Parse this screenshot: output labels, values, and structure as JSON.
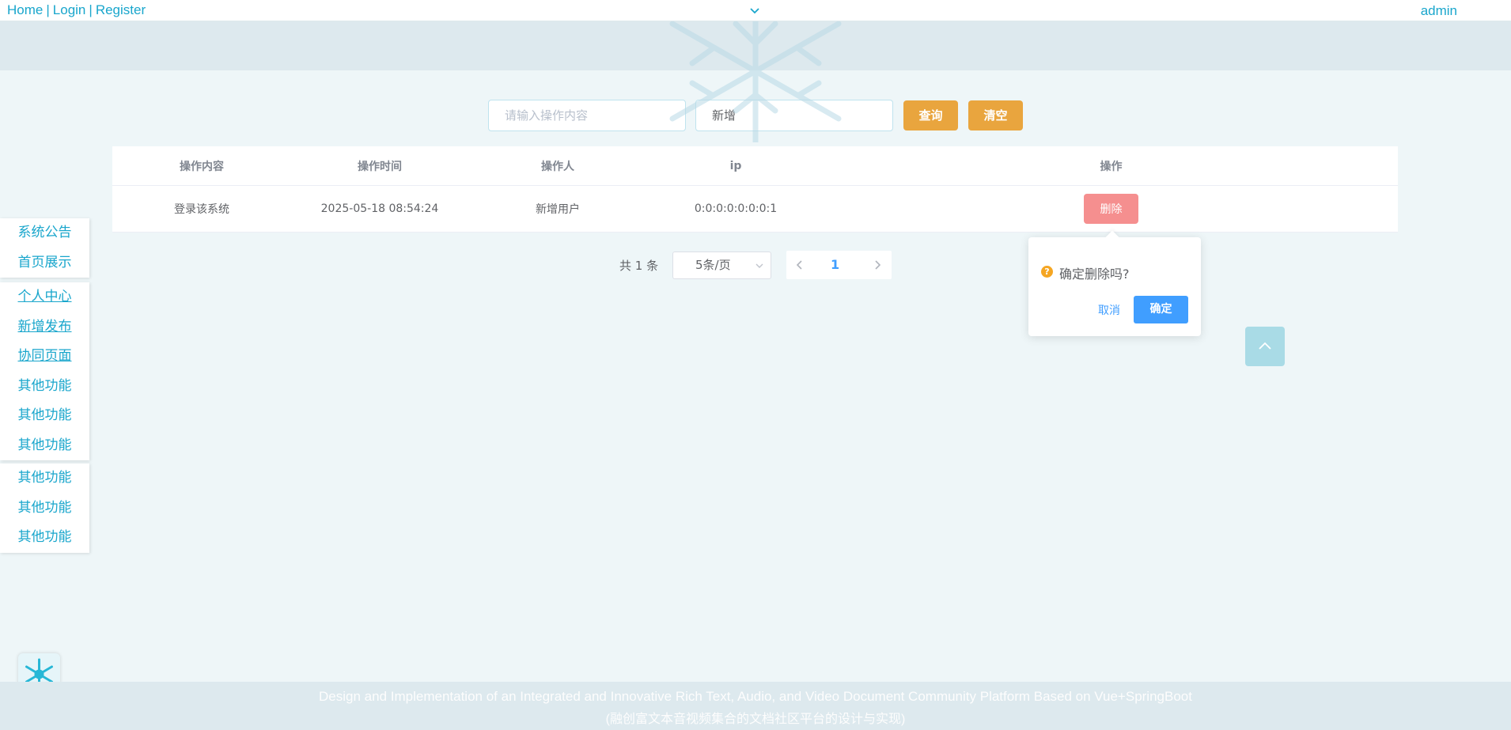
{
  "topnav": {
    "links": [
      "Home",
      "Login",
      "Register"
    ],
    "separator": "|",
    "user": "admin",
    "toggle_icon": "chevron-down-icon"
  },
  "search": {
    "content_placeholder": "请输入操作内容",
    "type_value": "新增",
    "query_label": "查询",
    "clear_label": "清空",
    "accent": "#e9a53e"
  },
  "table": {
    "headers": [
      "操作内容",
      "操作时间",
      "操作人",
      "ip",
      "操作"
    ],
    "rows": [
      {
        "content": "登录该系统",
        "time": "2025-05-18 08:54:24",
        "operator": "新增用户",
        "ip": "0:0:0:0:0:0:0:1",
        "delete_label": "删除"
      }
    ],
    "delete_color": "#f58f8f"
  },
  "pagination": {
    "total": "共 1 条",
    "page_size": "5条/页",
    "current_page": "1",
    "prev_icon": "chevron-left-icon",
    "next_icon": "chevron-right-icon"
  },
  "popconfirm": {
    "message": "确定删除吗?",
    "cancel_label": "取消",
    "confirm_label": "确定",
    "icon": "question-icon",
    "confirm_color": "#409eff"
  },
  "sidebar": {
    "groups": [
      [
        "系统公告",
        "首页展示"
      ],
      [
        "个人中心",
        "新增发布",
        "协同页面",
        "其他功能",
        "其他功能",
        "其他功能"
      ],
      [
        "其他功能",
        "其他功能",
        "其他功能"
      ]
    ],
    "accent": "#19a6cc"
  },
  "backtop": {
    "icon": "chevron-up-icon"
  },
  "widget": {
    "icon": "snowflake-icon"
  },
  "footer": {
    "line1": "Design and Implementation of an Integrated and Innovative Rich Text, Audio, and Video Document Community Platform Based on Vue+SpringBoot",
    "line2": "(融创富文本音视频集合的文档社区平台的设计与实现)"
  }
}
